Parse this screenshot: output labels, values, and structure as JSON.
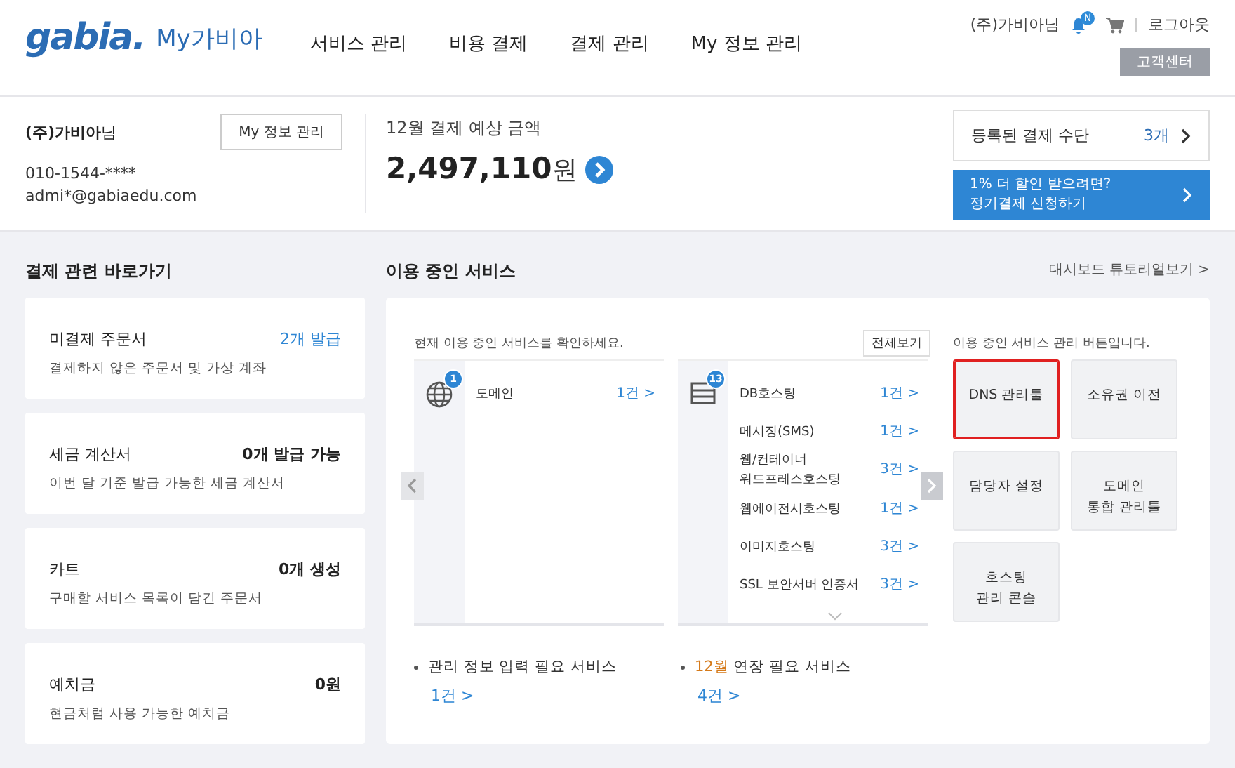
{
  "header": {
    "logo": "gabia.",
    "product": "My가비아",
    "nav": [
      {
        "label": "서비스 관리"
      },
      {
        "label": "비용 결제"
      },
      {
        "label": "결제 관리"
      },
      {
        "label": "My 정보 관리"
      }
    ],
    "user": "(주)가비아님",
    "notification_badge": "N",
    "logout": "로그아웃",
    "support": "고객센터"
  },
  "profile": {
    "name": "**(주)가비아**님",
    "phone": "010-1544-****",
    "email": "admi*@gabiaedu.com",
    "edit_button": "My 정보 관리"
  },
  "estimate": {
    "label": "12월 결제 예상 금액",
    "amount": "2,497,110",
    "unit": "원"
  },
  "payment_method": {
    "label": "등록된 결제 수단",
    "count": "3개"
  },
  "promo": {
    "line1": "1% 더 할인 받으려면?",
    "line2": "정기결제 신청하기"
  },
  "shortcuts": {
    "title": "결제 관련 바로가기",
    "cards": [
      {
        "title": "미결제 주문서",
        "value": "2개 발급",
        "highlight": true,
        "desc": "결제하지 않은 주문서 및 가상 계좌"
      },
      {
        "title": "세금 계산서",
        "value": "0개 발급 가능",
        "highlight": false,
        "desc": "이번 달 기준 발급 가능한 세금 계산서"
      },
      {
        "title": "카트",
        "value": "0개 생성",
        "highlight": false,
        "desc": "구매할 서비스 목록이 담긴 주문서"
      },
      {
        "title": "예치금",
        "value": "0원",
        "highlight": false,
        "desc": "현금처럼 사용 가능한 예치금"
      }
    ]
  },
  "services": {
    "title": "이용 중인 서비스",
    "tutorial_link": "대시보드 튜토리얼보기 >",
    "subtitle": "현재 이용 중인 서비스를 확인하세요.",
    "view_all": "전체보기",
    "prev_disabled": true,
    "next_disabled": false,
    "groups": [
      {
        "kind": "globe",
        "badge": "1",
        "more": false,
        "items": [
          {
            "name": [
              "도메인"
            ],
            "count": "1건 >"
          }
        ]
      },
      {
        "kind": "server",
        "badge": "13",
        "more": true,
        "items": [
          {
            "name": [
              "DB호스팅"
            ],
            "count": "1건 >"
          },
          {
            "name": [
              "메시징(SMS)"
            ],
            "count": "1건 >"
          },
          {
            "name": [
              "웹/컨테이너",
              "워드프레스호스팅"
            ],
            "count": "3건 >"
          },
          {
            "name": [
              "웹에이전시호스팅"
            ],
            "count": "1건 >"
          },
          {
            "name": [
              "이미지호스팅"
            ],
            "count": "3건 >"
          },
          {
            "name": [
              "SSL 보안서버 인증서"
            ],
            "count": "3건 >"
          }
        ]
      }
    ],
    "management": {
      "subtitle": "이용 중인 서비스 관리 버튼입니다.",
      "buttons": [
        {
          "lines": [
            "DNS 관리툴"
          ],
          "selected": true
        },
        {
          "lines": [
            "소유권 이전"
          ],
          "selected": false
        },
        {
          "lines": [
            "담당자 설정"
          ],
          "selected": false
        },
        {
          "lines": [
            "도메인",
            "통합 관리툴"
          ],
          "selected": false
        },
        {
          "lines": [
            "호스팅",
            "관리 콘솔"
          ],
          "selected": false
        }
      ]
    },
    "notes": [
      {
        "text": "관리 정보 입력 필요 서비스",
        "count": "1건 >"
      },
      {
        "highlight": "12월",
        "text": "연장 필요 서비스",
        "count": "4건 >"
      }
    ]
  }
}
